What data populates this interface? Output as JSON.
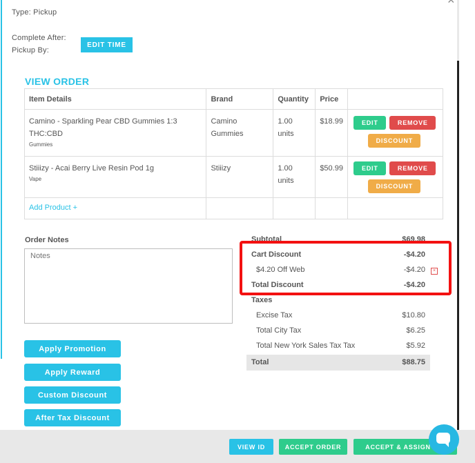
{
  "order": {
    "type_line": "Type: Pickup",
    "complete_after_label": "Complete After:",
    "pickup_by_label": "Pickup By:",
    "edit_time_label": "EDIT TIME"
  },
  "view_order": {
    "title": "VIEW ORDER",
    "columns": [
      "Item Details",
      "Brand",
      "Quantity",
      "Price"
    ],
    "items": [
      {
        "name_line1": "Camino - Sparkling Pear CBD Gummies 1:3",
        "name_line2": "THC:CBD",
        "category": "Gummies",
        "brand_line1": "Camino",
        "brand_line2": "Gummies",
        "quantity_line1": "1.00",
        "quantity_line2": "units",
        "price": "$18.99"
      },
      {
        "name_line1": "Stiiizy - Acai Berry Live Resin Pod 1g",
        "category": "Vape",
        "brand_line1": "Stiiizy",
        "quantity_line1": "1.00",
        "quantity_line2": "units",
        "price": "$50.99"
      }
    ],
    "edit_label": "EDIT",
    "remove_label": "REMOVE",
    "discount_label": "DISCOUNT",
    "add_product_label": "Add Product +"
  },
  "notes": {
    "label": "Order Notes",
    "placeholder": "Notes"
  },
  "actions": {
    "apply_promotion": "Apply Promotion",
    "apply_reward": "Apply Reward",
    "custom_discount": "Custom Discount",
    "after_tax_discount": "After Tax Discount"
  },
  "summary": {
    "subtotal_label": "Subtotal",
    "subtotal_value": "$69.98",
    "cart_discount_label": "Cart Discount",
    "cart_discount_value": "-$4.20",
    "web_discount_label": "$4.20 Off Web",
    "web_discount_value": "-$4.20",
    "total_discount_label": "Total Discount",
    "total_discount_value": "-$4.20",
    "taxes_label": "Taxes",
    "excise_label": "Excise Tax",
    "excise_value": "$10.80",
    "city_label": "Total City Tax",
    "city_value": "$6.25",
    "ny_label": "Total New York Sales Tax Tax",
    "ny_value": "$5.92",
    "total_label": "Total",
    "total_value": "$88.75"
  },
  "footer": {
    "view_id": "VIEW ID",
    "accept_order": "ACCEPT ORDER",
    "accept_assign": "ACCEPT & ASSIGN O..."
  },
  "icons": {
    "close": "close-icon",
    "remove_discount": "remove-discount-icon",
    "chat": "chat-icon"
  },
  "colors": {
    "accent": "#29c2e6",
    "edit": "#2ecc8c",
    "remove": "#e04b4b",
    "discount": "#f0ac48",
    "highlight_frame": "#f31111"
  }
}
